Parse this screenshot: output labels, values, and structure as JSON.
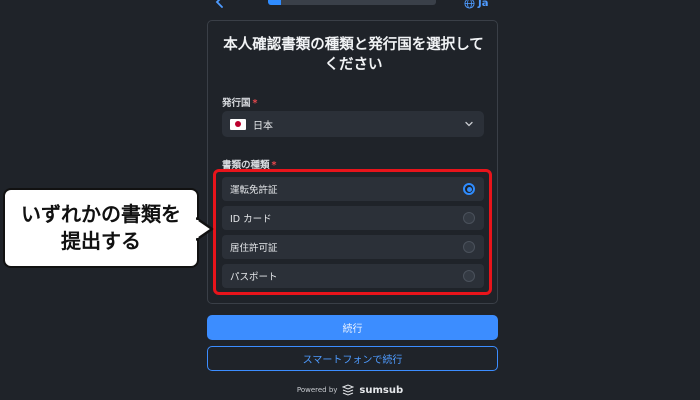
{
  "header": {
    "progress_fraction": 0.08,
    "language": "Ja",
    "back_icon": "chevron-left-icon",
    "language_icon": "globe-icon"
  },
  "card": {
    "title": "本人確認書類の種類と発行国を選択してください",
    "country_label": "発行国",
    "required_mark": "*",
    "country_value": "日本",
    "country_flag_icon": "japan-flag-icon",
    "doc_type_label": "書類の種類",
    "options": [
      {
        "label": "運転免許証",
        "selected": true
      },
      {
        "label": "ID カード",
        "selected": false
      },
      {
        "label": "居住許可証",
        "selected": false
      },
      {
        "label": "パスポート",
        "selected": false
      }
    ]
  },
  "callout": {
    "line1": "いずれかの書類を",
    "line2": "提出する"
  },
  "buttons": {
    "continue": "続行",
    "continue_phone": "スマートフォンで続行"
  },
  "footer": {
    "powered_by": "Powered by",
    "brand": "sumsub"
  },
  "colors": {
    "accent": "#3c8dff",
    "required": "#e5484d",
    "highlight": "#e8141b",
    "background": "#1f2329"
  }
}
